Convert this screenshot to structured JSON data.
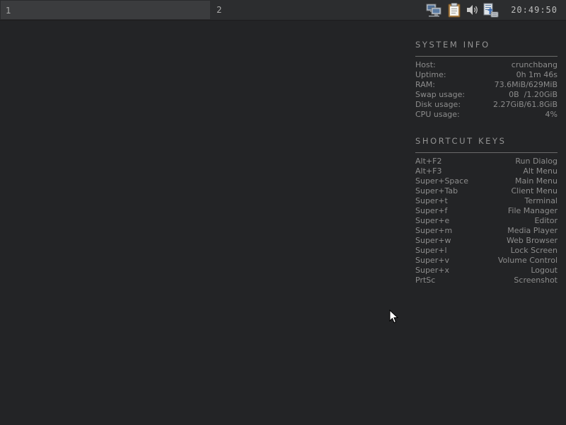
{
  "panel": {
    "workspaces": [
      {
        "label": "1",
        "active": true
      },
      {
        "label": "2",
        "active": false
      }
    ],
    "tray": [
      {
        "icon": "network-icon"
      },
      {
        "icon": "clipboard-icon"
      },
      {
        "icon": "volume-icon"
      },
      {
        "icon": "update-manager-icon"
      }
    ],
    "clock": "20:49:50"
  },
  "system_info": {
    "title": "SYSTEM INFO",
    "rows": [
      {
        "key": "Host:",
        "value": "crunchbang"
      },
      {
        "key": "Uptime:",
        "value": "0h 1m 46s"
      },
      {
        "key": "RAM:",
        "value": "73.6MiB/629MiB"
      },
      {
        "key": "Swap usage:",
        "value": "0B  /1.20GiB"
      },
      {
        "key": "Disk usage:",
        "value": "2.27GiB/61.8GiB"
      },
      {
        "key": "CPU usage:",
        "value": "4%"
      }
    ]
  },
  "shortcut_keys": {
    "title": "SHORTCUT KEYS",
    "rows": [
      {
        "key": "Alt+F2",
        "value": "Run Dialog"
      },
      {
        "key": "Alt+F3",
        "value": "Alt Menu"
      },
      {
        "key": "Super+Space",
        "value": "Main Menu"
      },
      {
        "key": "Super+Tab",
        "value": "Client Menu"
      },
      {
        "key": "Super+t",
        "value": "Terminal"
      },
      {
        "key": "Super+f",
        "value": "File Manager"
      },
      {
        "key": "Super+e",
        "value": "Editor"
      },
      {
        "key": "Super+m",
        "value": "Media Player"
      },
      {
        "key": "Super+w",
        "value": "Web Browser"
      },
      {
        "key": "Super+l",
        "value": "Lock Screen"
      },
      {
        "key": "Super+v",
        "value": "Volume Control"
      },
      {
        "key": "Super+x",
        "value": "Logout"
      },
      {
        "key": "PrtSc",
        "value": "Screenshot"
      }
    ]
  },
  "colors": {
    "desktop_bg": "#232426",
    "panel_bg": "#2c2d2f",
    "active_workspace_bg": "#3b3c3e",
    "conky_text": "#8c8c8c"
  }
}
